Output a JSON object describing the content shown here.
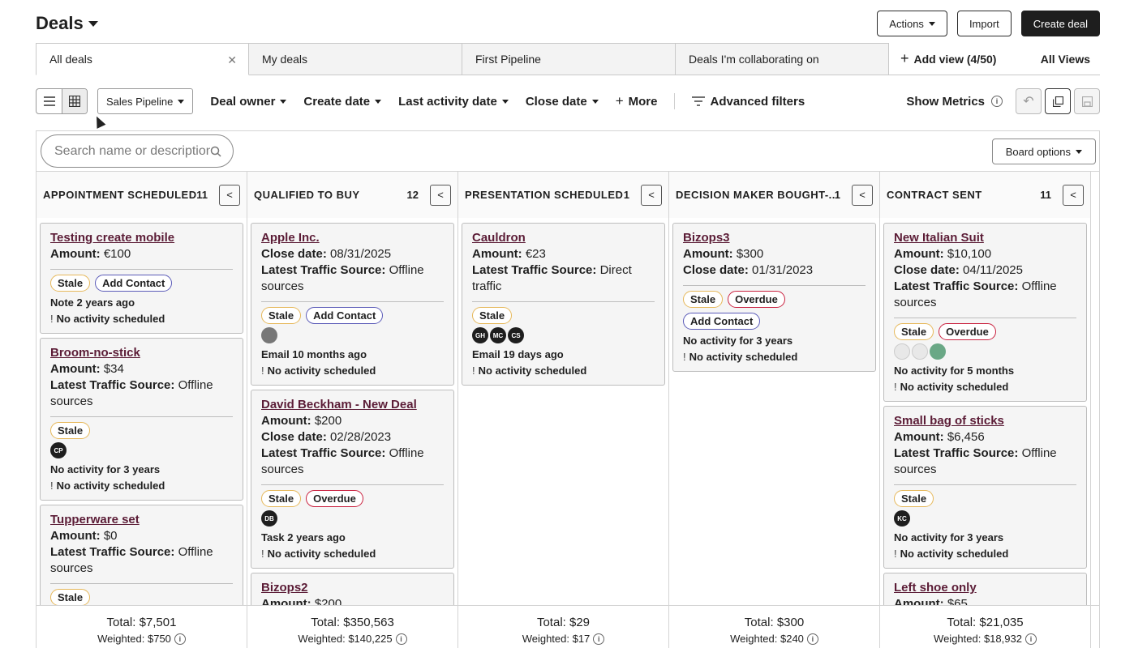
{
  "header": {
    "title": "Deals",
    "actions_label": "Actions",
    "import_label": "Import",
    "create_label": "Create deal"
  },
  "tabs": [
    {
      "label": "All deals"
    },
    {
      "label": "My deals"
    },
    {
      "label": "First Pipeline"
    },
    {
      "label": "Deals I'm collaborating on"
    }
  ],
  "tab_extra": {
    "add_view": "Add view (4/50)",
    "all_views": "All Views"
  },
  "filters": {
    "pipeline": "Sales Pipeline",
    "deal_owner": "Deal owner",
    "create_date": "Create date",
    "last_activity": "Last activity date",
    "close_date": "Close date",
    "more": "More",
    "advanced": "Advanced filters",
    "show_metrics": "Show Metrics"
  },
  "board": {
    "search_placeholder": "Search name or description",
    "board_options": "Board options"
  },
  "columns": [
    {
      "title": "APPOINTMENT SCHEDULED",
      "count": "11",
      "total": "Total: $7,501",
      "weighted": "Weighted: $750"
    },
    {
      "title": "QUALIFIED TO BUY",
      "count": "12",
      "total": "Total: $350,563",
      "weighted": "Weighted: $140,225"
    },
    {
      "title": "PRESENTATION SCHEDULED",
      "count": "1",
      "total": "Total: $29",
      "weighted": "Weighted: $17"
    },
    {
      "title": "DECISION MAKER BOUGHT-...",
      "count": "1",
      "total": "Total: $300",
      "weighted": "Weighted: $240"
    },
    {
      "title": "CONTRACT SENT",
      "count": "11",
      "total": "Total: $21,035",
      "weighted": "Weighted: $18,932"
    }
  ],
  "labels": {
    "amount": "Amount:",
    "close_date": "Close date:",
    "traffic": "Latest Traffic Source:",
    "stale": "Stale",
    "overdue": "Overdue",
    "add_contact": "Add Contact",
    "no_activity_scheduled": "No activity scheduled"
  },
  "cards": {
    "c1a": {
      "name": "Testing create mobile",
      "amount": "€100",
      "activity": "Note 2 years ago"
    },
    "c1b": {
      "name": "Broom-no-stick",
      "amount": "$34",
      "traffic": "Offline sources",
      "avatar": "CP",
      "activity": "No activity for 3 years"
    },
    "c1c": {
      "name": "Tupperware set",
      "amount": "$0",
      "traffic": "Offline sources"
    },
    "c2a": {
      "name": "Apple Inc.",
      "close": "08/31/2025",
      "traffic": "Offline sources",
      "activity": "Email 10 months ago"
    },
    "c2b": {
      "name": "David Beckham - New Deal",
      "amount": "$200",
      "close": "02/28/2023",
      "traffic": "Offline sources",
      "avatar": "DB",
      "activity": "Task 2 years ago"
    },
    "c2c": {
      "name": "Bizops2",
      "amount": "$200"
    },
    "c3a": {
      "name": "Cauldron",
      "amount": "€23",
      "traffic": "Direct traffic",
      "avatars": [
        "GH",
        "MC",
        "CS"
      ],
      "activity": "Email 19 days ago"
    },
    "c4a": {
      "name": "Bizops3",
      "amount": "$300",
      "close": "01/31/2023",
      "activity": "No activity for 3 years"
    },
    "c5a": {
      "name": "New Italian Suit",
      "amount": "$10,100",
      "close": "04/11/2025",
      "traffic": "Offline sources",
      "activity": "No activity for 5 months"
    },
    "c5b": {
      "name": "Small bag of sticks",
      "amount": "$6,456",
      "traffic": "Offline sources",
      "avatar": "KC",
      "activity": "No activity for 3 years"
    },
    "c5c": {
      "name": "Left shoe only",
      "amount": "$65"
    }
  }
}
